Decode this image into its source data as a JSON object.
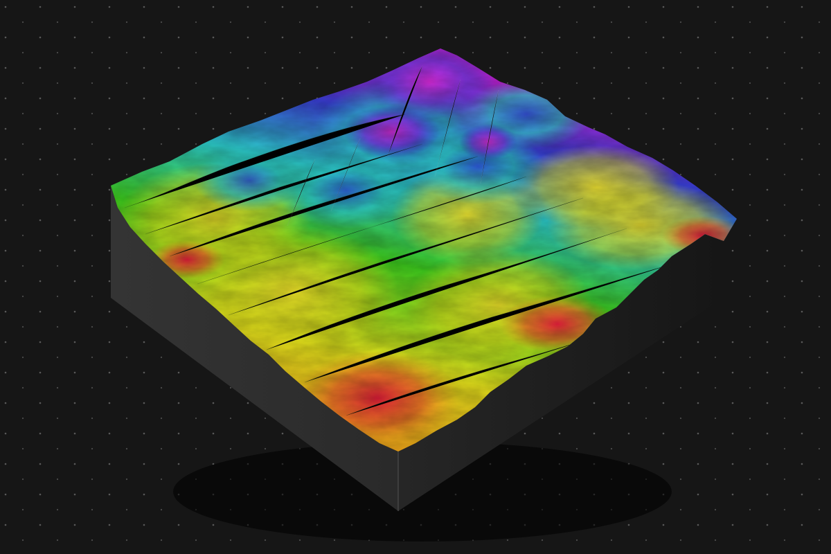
{
  "scene": {
    "background_color": "#161616",
    "grid_dot_color": "#5d5d5d",
    "block_top_color": "#3a3a3a",
    "block_left_color": "#2b2b2b",
    "block_right_color": "#1d1d1d"
  },
  "elevation_ramp": {
    "low": "#e8143a",
    "low_mid": "#f0a21a",
    "mid": "#e9e21c",
    "mid_high": "#3fd11e",
    "high": "#2cc9c9",
    "higher": "#3a3fd8",
    "peak": "#cc1fd6"
  }
}
